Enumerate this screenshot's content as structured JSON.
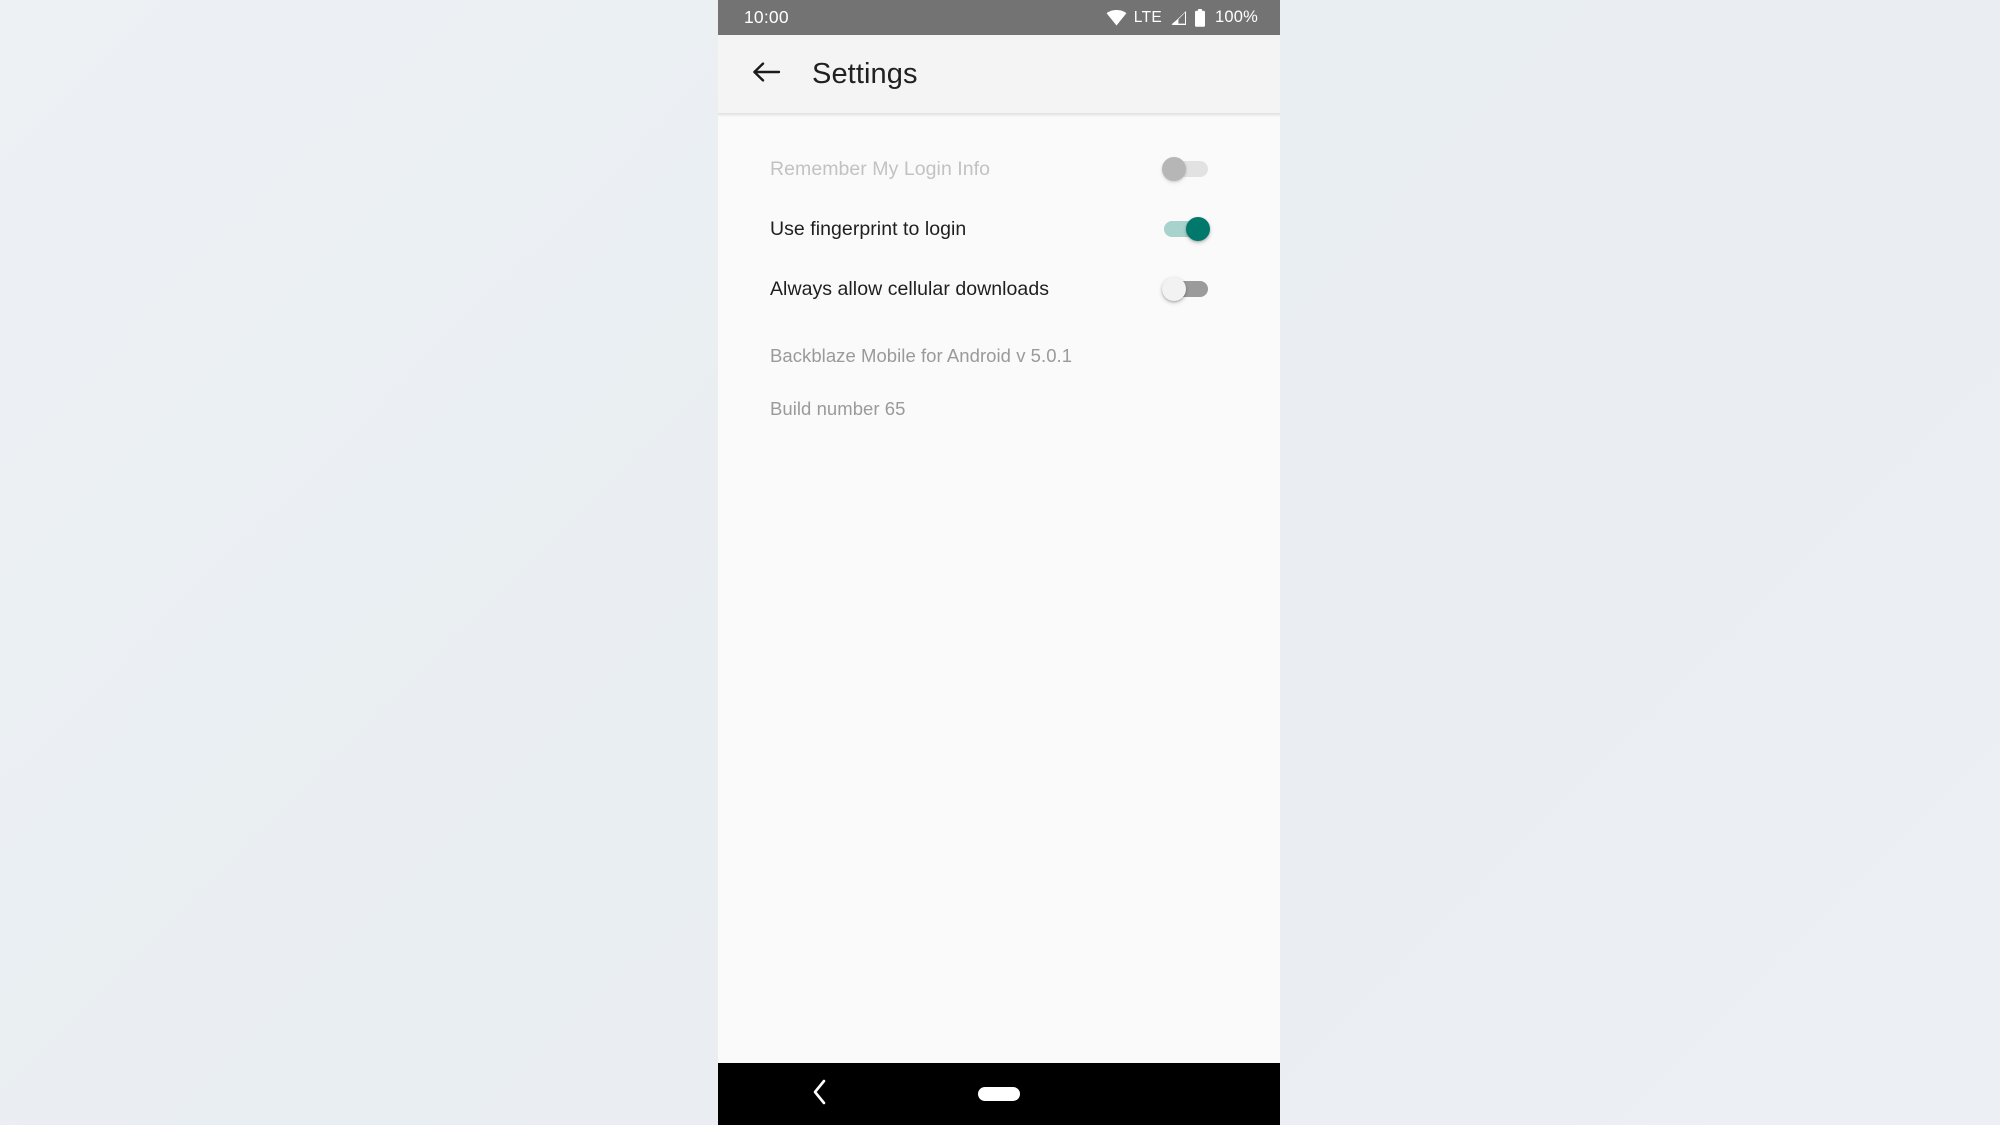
{
  "status_bar": {
    "time": "10:00",
    "network_label": "LTE",
    "battery_percent": "100%",
    "wifi_icon": "wifi-icon",
    "signal_icon": "cellular-signal-icon",
    "battery_icon": "battery-full-icon",
    "background_color": "#737373",
    "text_color": "#FFFFFF"
  },
  "app_bar": {
    "back_icon": "arrow-left-icon",
    "title": "Settings",
    "background_color": "#F4F4F4",
    "title_color": "#212121"
  },
  "settings": {
    "rows": [
      {
        "label": "Remember My Login Info",
        "state": "off",
        "enabled": false,
        "name": "remember-login-info"
      },
      {
        "label": "Use fingerprint to login",
        "state": "on",
        "enabled": true,
        "name": "use-fingerprint-to-login"
      },
      {
        "label": "Always allow cellular downloads",
        "state": "off",
        "enabled": true,
        "name": "always-allow-cellular-downloads"
      }
    ]
  },
  "about": {
    "app_version": "Backblaze Mobile for Android v 5.0.1",
    "build_number": "Build number 65",
    "text_color": "#9A9A9A"
  },
  "nav_bar": {
    "back_icon": "chevron-left-icon",
    "home_indicator": "home-pill-indicator",
    "background_color": "#000000"
  },
  "theme": {
    "accent_teal": "#00786B",
    "accent_teal_track": "#A8D3CD",
    "toggle_off_track": "#9B9B9B",
    "toggle_off_thumb": "#F2F2F2",
    "toggle_disabled_track": "#E2E2E2",
    "toggle_disabled_thumb": "#B6B6B6",
    "screen_background": "#FAFAFA",
    "page_background": "#EAEFF3"
  }
}
